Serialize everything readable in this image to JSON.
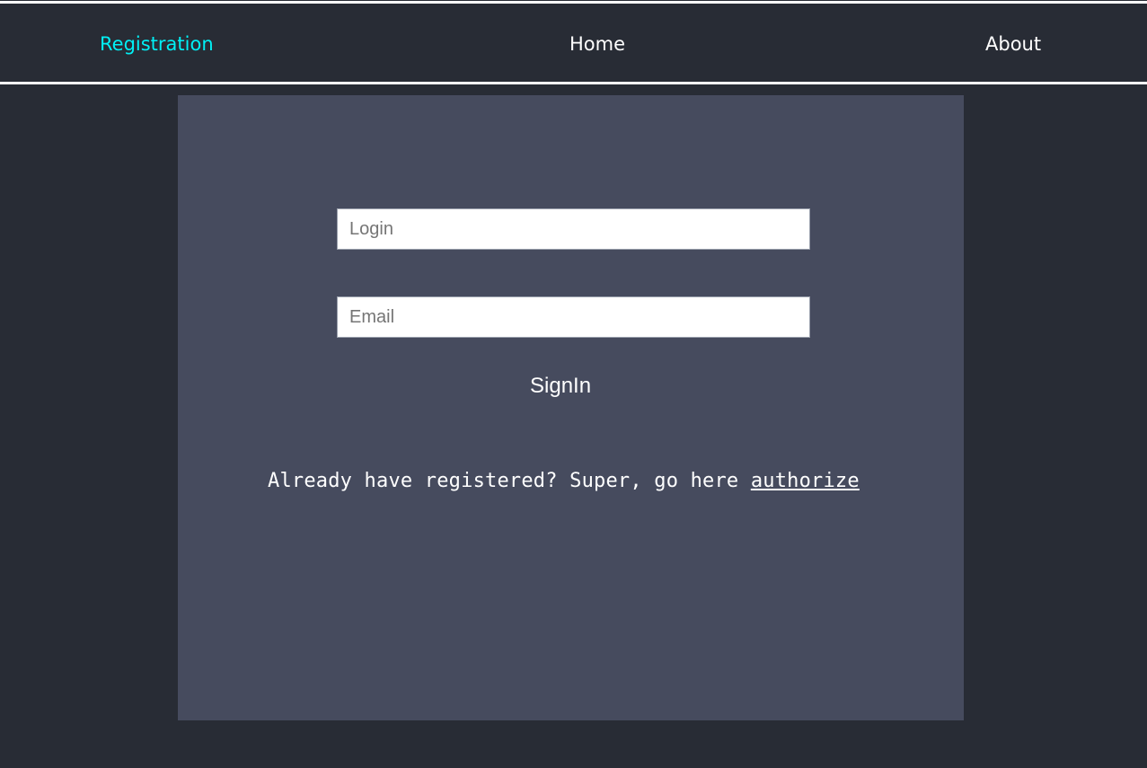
{
  "nav": {
    "items": [
      {
        "label": "Registration",
        "active": true
      },
      {
        "label": "Home",
        "active": false
      },
      {
        "label": "About",
        "active": false
      }
    ],
    "active_color": "#00f0f5"
  },
  "form": {
    "login": {
      "placeholder": "Login",
      "value": ""
    },
    "email": {
      "placeholder": "Email",
      "value": ""
    },
    "submit_label": "SignIn"
  },
  "prompt": {
    "text": "Already have registered? Super, go here ",
    "link_label": "authorize"
  },
  "colors": {
    "background": "#282c35",
    "panel": "#464b5e",
    "text": "#ffffff"
  }
}
